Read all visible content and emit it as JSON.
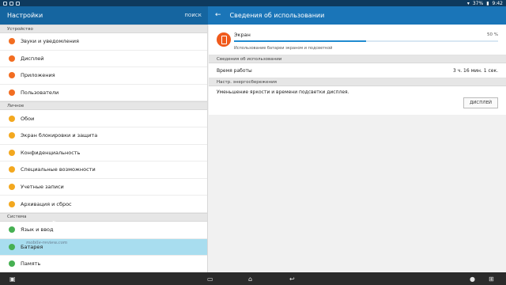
{
  "status_bar": {
    "battery": "37%",
    "time": "9:42"
  },
  "left": {
    "title": "Настройки",
    "search": "ПОИСК",
    "sections": [
      {
        "header": "Устройство",
        "items": [
          {
            "label": "Звуки и уведомления",
            "color": "#f26d21"
          },
          {
            "label": "Дисплей",
            "color": "#f26d21"
          },
          {
            "label": "Приложения",
            "color": "#f26d21"
          },
          {
            "label": "Пользователи",
            "color": "#f26d21"
          }
        ]
      },
      {
        "header": "Личное",
        "items": [
          {
            "label": "Обои",
            "color": "#f3a81f"
          },
          {
            "label": "Экран блокировки и защита",
            "color": "#f3a81f"
          },
          {
            "label": "Конфиденциальность",
            "color": "#f3a81f"
          },
          {
            "label": "Специальные возможности",
            "color": "#f3a81f"
          },
          {
            "label": "Учетные записи",
            "color": "#f3a81f"
          },
          {
            "label": "Архивация и сброс",
            "color": "#f3a81f"
          }
        ]
      },
      {
        "header": "Система",
        "items": [
          {
            "label": "Язык и ввод",
            "color": "#46b052"
          },
          {
            "label": "Батарея",
            "color": "#46b052",
            "selected": true
          },
          {
            "label": "Память",
            "color": "#46b052"
          }
        ]
      }
    ]
  },
  "right": {
    "title": "Сведения об использовании",
    "screen": {
      "name": "Экран",
      "percent": "50 %",
      "progress_fraction": 0.5,
      "description": "Использование батареи экраном и подсветкой"
    },
    "usage_header": "Сведения об использовании",
    "uptime_label": "Время работы",
    "uptime_value": "3 ч. 16 мин. 1 сек.",
    "power_header": "Настр. энергосбережения",
    "power_text": "Уменьшение яркости и времени подсветки дисплея.",
    "display_button": "ДИСПЛЕЙ"
  },
  "watermark": "mobile-review.com",
  "colors": {
    "status_bar": "#0e3a5e",
    "left_bar": "#1565a0",
    "right_bar": "#1a75b8",
    "selected": "#a8ddef",
    "accent": "#f05a1c"
  }
}
